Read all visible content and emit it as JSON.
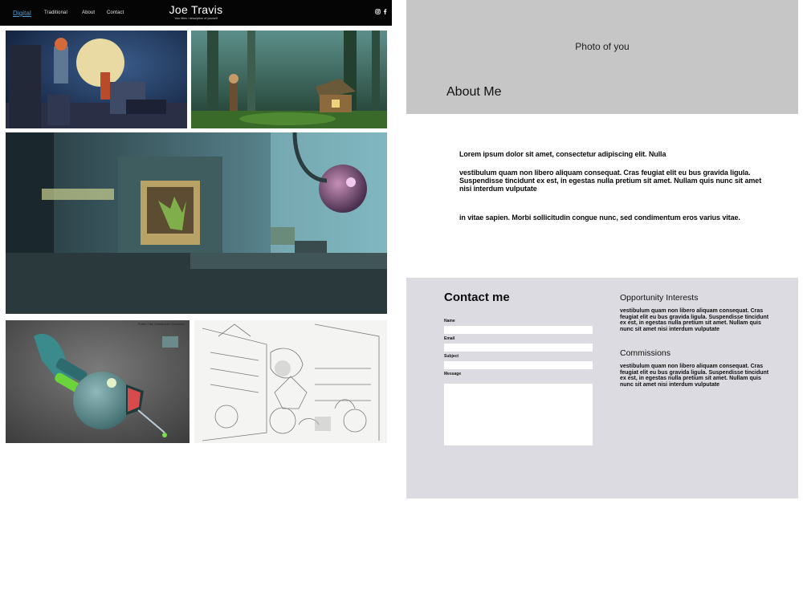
{
  "nav": {
    "items": [
      "Digital",
      "Traditional",
      "About",
      "Contact"
    ],
    "active": "Digital"
  },
  "brand": {
    "name": "Joe Travis",
    "tagline": "Your titles / description of yourself"
  },
  "social": {
    "instagram_icon": "instagram-icon",
    "facebook_icon": "facebook-icon"
  },
  "gallery": {
    "caption_4": "Puffer Fish Gelatinizer Converter"
  },
  "about": {
    "photo_placeholder": "Photo of you",
    "title": "About Me",
    "paragraphs": [
      "Lorem ipsum dolor sit amet, consectetur adipiscing elit. Nulla",
      "vestibulum quam non libero aliquam consequat. Cras feugiat elit eu bus gravida ligula. Suspendisse tincidunt ex est, in egestas nulla pretium sit amet. Nullam quis nunc sit amet nisi interdum vulputate",
      "in vitae sapien. Morbi sollicitudin congue nunc, sed condimentum eros varius vitae."
    ]
  },
  "contact": {
    "title": "Contact me",
    "labels": {
      "name": "Name",
      "email": "Email",
      "subject": "Subject",
      "message": "Message"
    },
    "values": {
      "name": "",
      "email": "",
      "subject": "",
      "message": ""
    },
    "opportunity_title": "Opportunity Interests",
    "opportunity_text": "vestibulum quam non libero aliquam consequat. Cras feugiat elit eu bus gravida ligula. Suspendisse tincidunt ex est, in egestas nulla pretium sit amet. Nullam quis nunc sit amet nisi interdum vulputate",
    "commissions_title": "Commissions",
    "commissions_text": "vestibulum quam non libero aliquam consequat. Cras feugiat elit eu bus gravida ligula. Suspendisse tincidunt ex est, in egestas nulla pretium sit amet. Nullam quis nunc sit amet nisi interdum vulputate"
  },
  "colors": {
    "header_bg": "#050505",
    "nav_active": "#4fa0d6",
    "photo_block": "#c6c6c6",
    "contact_block": "#dcdbe1"
  }
}
